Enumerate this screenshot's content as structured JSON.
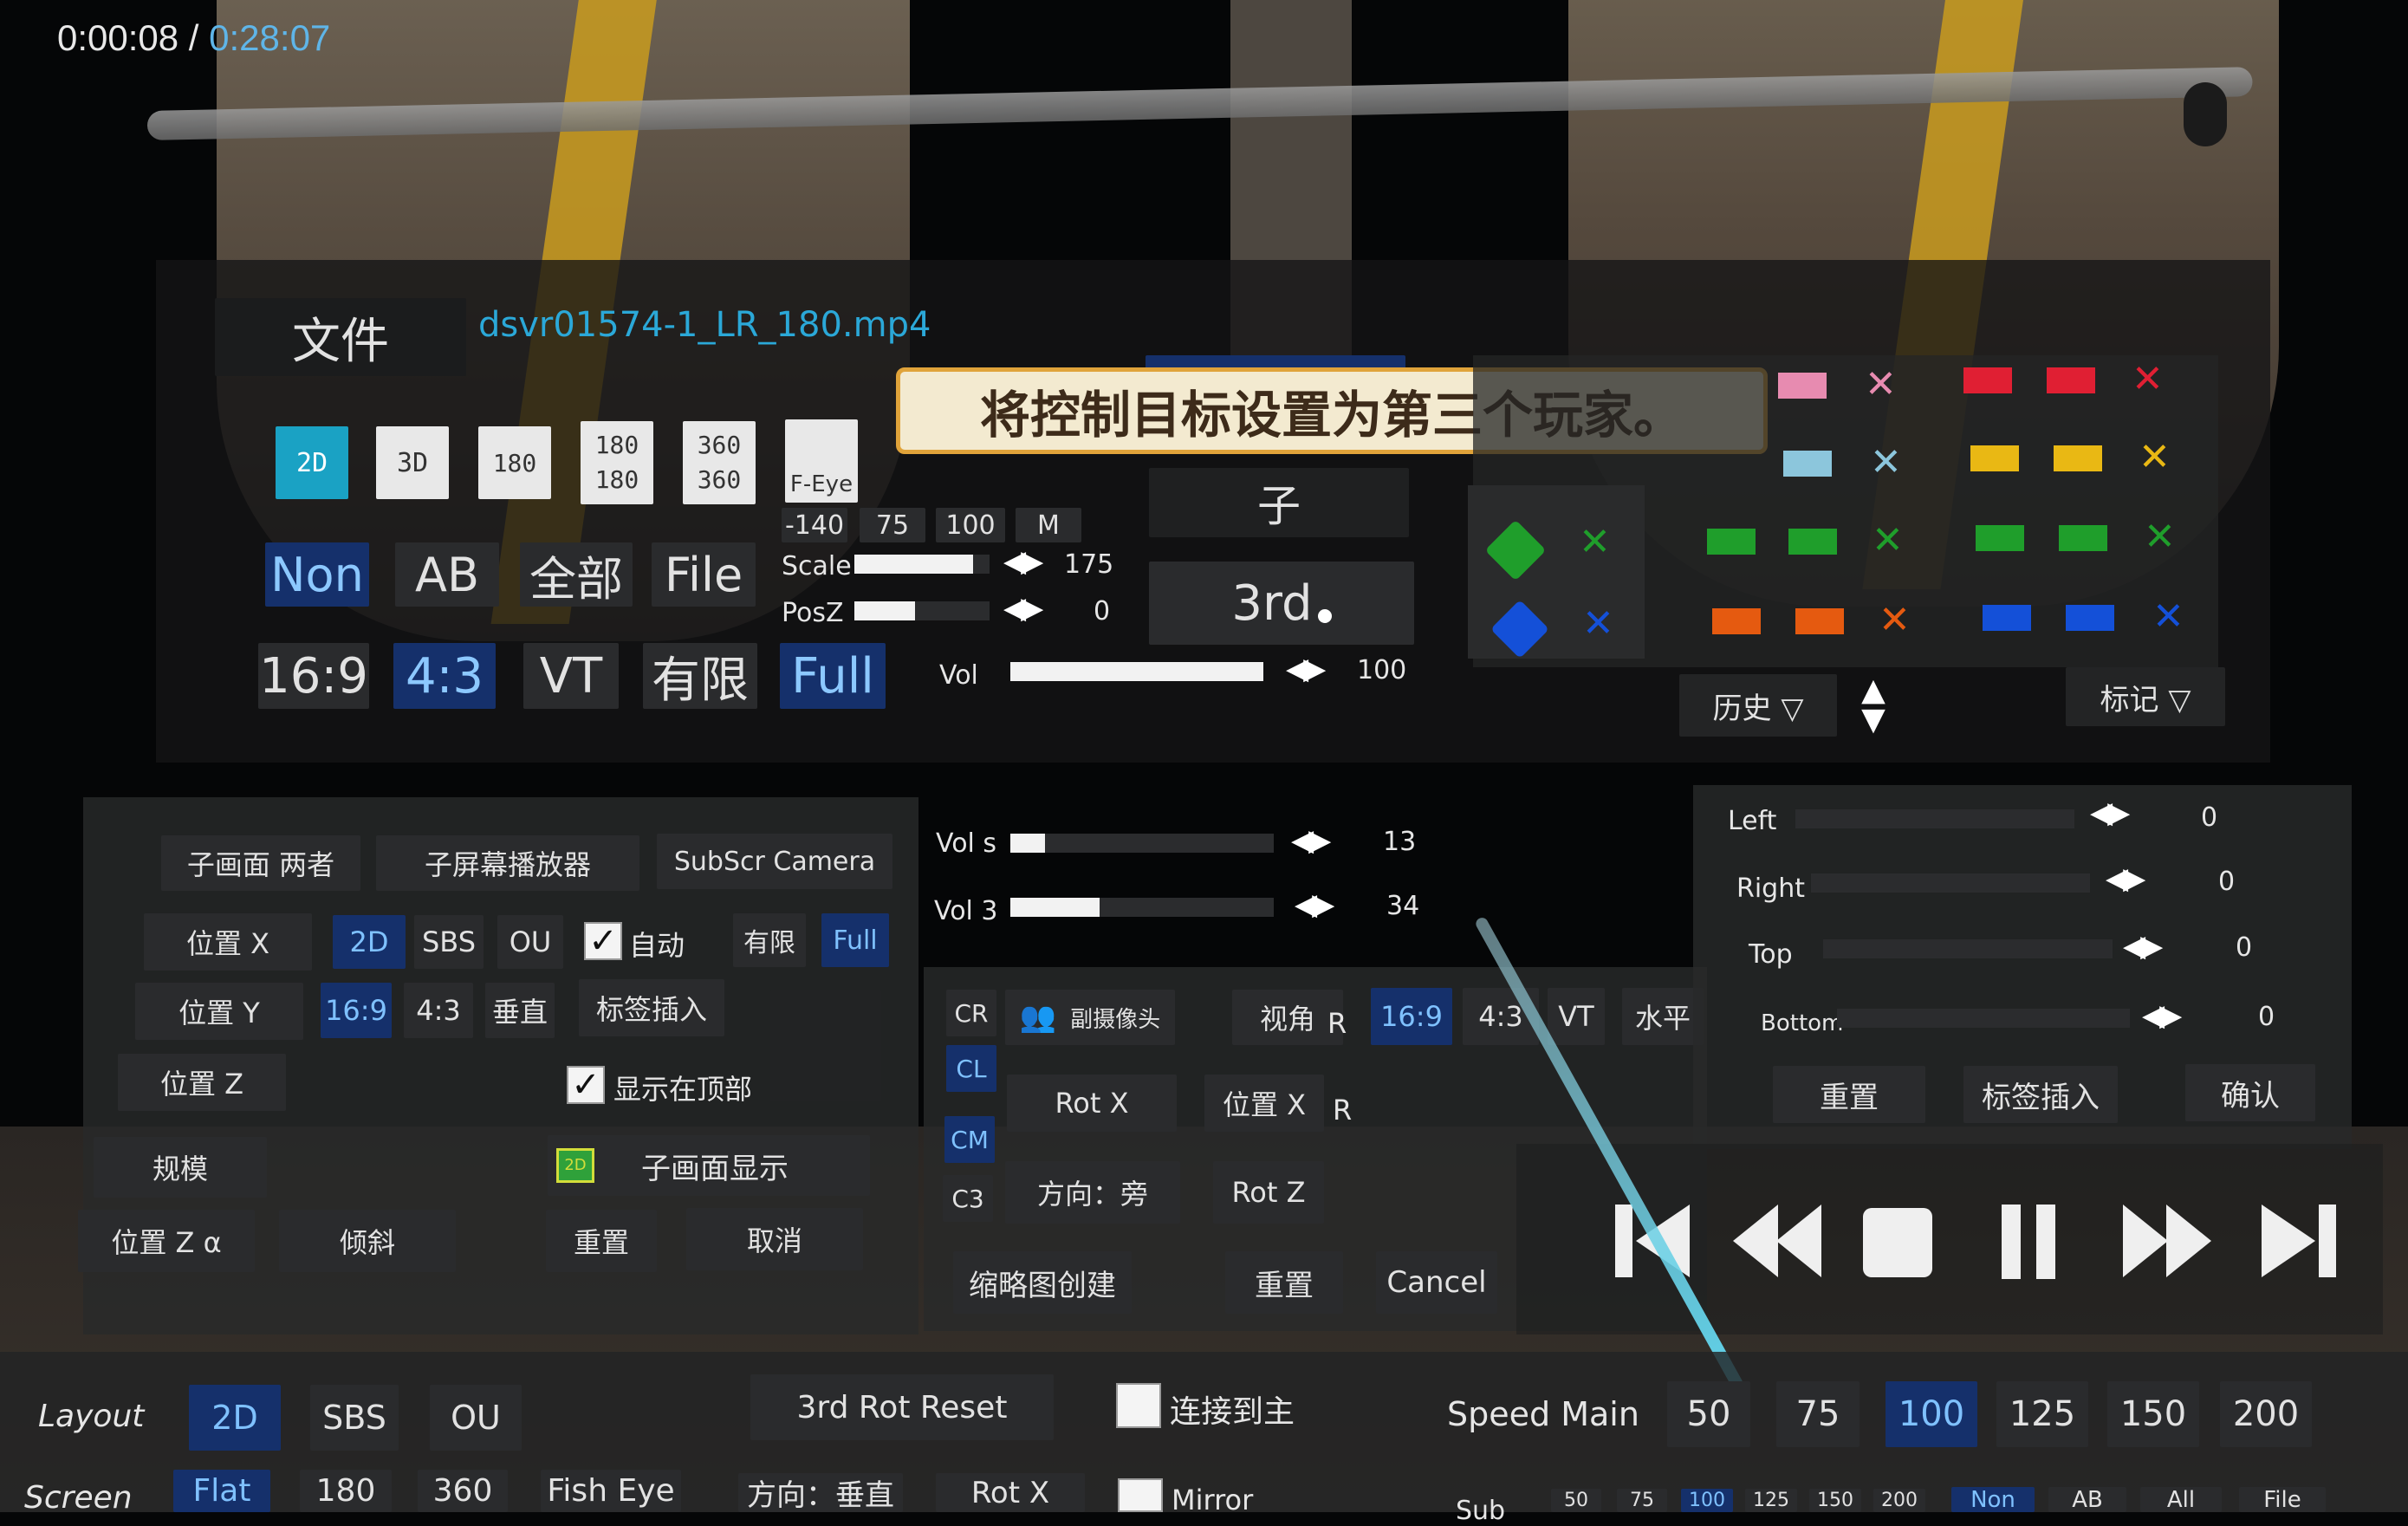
{
  "time": {
    "current": "0:00:08",
    "separator": " / ",
    "total": "0:28:07"
  },
  "file": {
    "button_label": "文件",
    "filename": "dsvr01574-1_LR_180.mp4"
  },
  "tooltip": "将控制目标设置为第三个玩家。",
  "format_buttons": [
    "2D",
    "3D",
    "180",
    "180\n180",
    "360\n360",
    "F-Eye"
  ],
  "mode_row": [
    "Non",
    "AB",
    "全部",
    "File"
  ],
  "aspect_row": [
    "16:9",
    "4:3",
    "VT",
    "有限",
    "Full"
  ],
  "preset_values": [
    "-140",
    "75",
    "100",
    "M"
  ],
  "sliders": [
    {
      "label": "Scale",
      "value": "175",
      "level": 0.88
    },
    {
      "label": "PosZ",
      "value": "0",
      "level": 0.45
    },
    {
      "label": "Vol",
      "value": "100",
      "level": 1.0
    }
  ],
  "center": {
    "partial_top": "子",
    "third": "3rd"
  },
  "history_label": "历史 ▽",
  "mark_label": "标记 ▽",
  "marker_colors": {
    "pink": "#e78bb0",
    "lightblue": "#8cc6dc",
    "red": "#e01f33",
    "yellow": "#e9b814",
    "green": "#1f9e2b",
    "orange": "#e55a10",
    "blue": "#1450d8"
  },
  "subscreen": {
    "tabs": [
      "子画面 两者",
      "子屏幕播放器",
      "SubScr Camera"
    ],
    "rows": {
      "pos_x": "位置 X",
      "pos_y": "位置 Y",
      "pos_z": "位置 Z",
      "scale": "规模",
      "pos_za": "位置 Z α",
      "tilt": "倾斜"
    },
    "row1_buttons": [
      "2D",
      "SBS",
      "OU"
    ],
    "auto_label": "自动",
    "limited": "有限",
    "full": "Full",
    "row2_buttons": [
      "16:9",
      "4:3",
      "垂直"
    ],
    "tag_insert": "标签插入",
    "show_on_top": "显示在顶部",
    "sub_display": "子画面显示",
    "reset": "重置",
    "cancel": "取消"
  },
  "vol_panel": [
    {
      "label": "Vol s",
      "value": "13",
      "level": 0.13
    },
    {
      "label": "Vol 3",
      "value": "34",
      "level": 0.34
    }
  ],
  "camera_panel": {
    "side": [
      "CR",
      "CL",
      "CM",
      "C3"
    ],
    "sub_camera": "副摄像头",
    "view": "视角",
    "r1": "R",
    "aspect": [
      "16:9",
      "4:3",
      "VT",
      "水平"
    ],
    "rot_x": "Rot X",
    "pos_x": "位置 X",
    "r2": "R",
    "direction": "方向：旁",
    "rot_z": "Rot Z",
    "thumbnail": "缩略图创建",
    "reset": "重置",
    "cancel": "Cancel"
  },
  "crop_panel": {
    "rows": [
      {
        "label": "Left",
        "value": "0"
      },
      {
        "label": "Right",
        "value": "0"
      },
      {
        "label": "Top",
        "value": "0"
      },
      {
        "label": "Bottom",
        "value": "0"
      }
    ],
    "reset": "重置",
    "tag_insert": "标签插入",
    "confirm": "确认"
  },
  "transport": [
    "skip-back",
    "rewind",
    "stop",
    "pause",
    "fast-forward",
    "skip-forward"
  ],
  "bottom": {
    "layout_label": "Layout",
    "layout_buttons": [
      "2D",
      "SBS",
      "OU"
    ],
    "screen_label": "Screen",
    "screen_buttons": [
      "Flat",
      "180",
      "360",
      "Fish Eye"
    ],
    "rot_reset": "3rd Rot Reset",
    "connect": "连接到主",
    "direction_vertical": "方向：垂直",
    "rot_x": "Rot X",
    "mirror": "Mirror",
    "speed_label": "Speed Main",
    "speeds": [
      "50",
      "75",
      "100",
      "125",
      "150",
      "200"
    ],
    "sub_label": "Sub",
    "sub_speeds": [
      "50",
      "75",
      "100",
      "125",
      "150",
      "200"
    ],
    "sub_modes": [
      "Non",
      "AB",
      "All",
      "File"
    ]
  }
}
